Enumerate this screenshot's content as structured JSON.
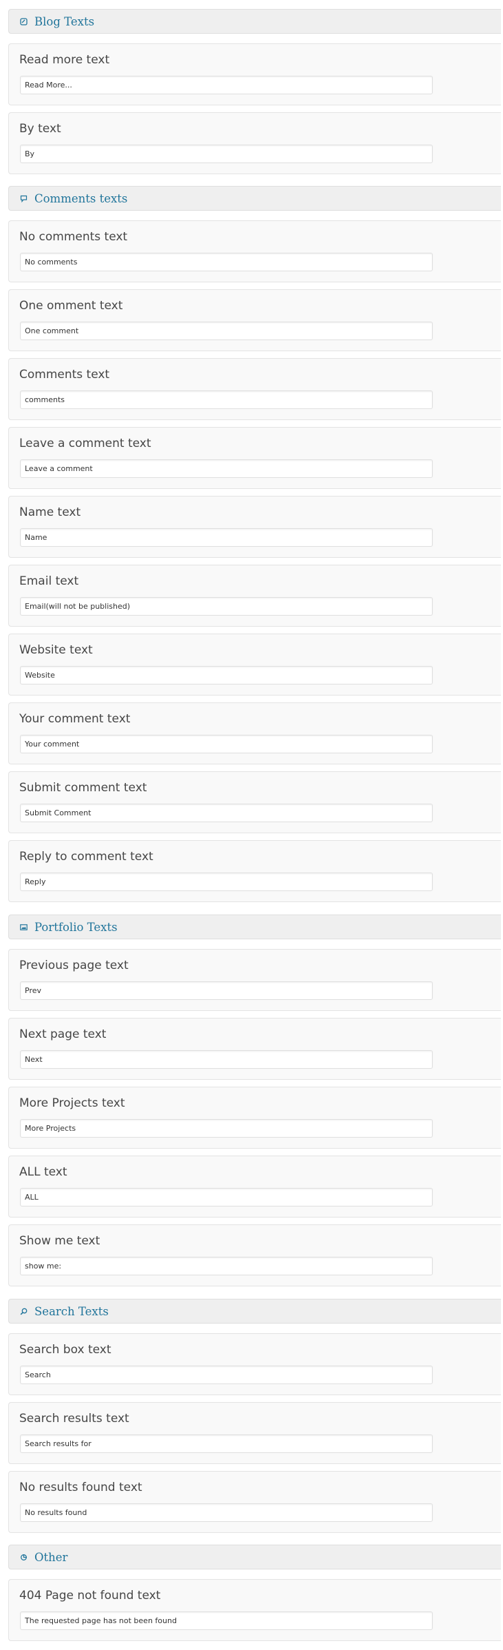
{
  "colors": {
    "section_title": "#21759b",
    "header_bg": "#efefef",
    "box_bg": "#f9f9f9",
    "label": "#464646"
  },
  "sections": [
    {
      "title": "Blog Texts",
      "icon": "blog-icon",
      "fields": [
        {
          "label": "Read more text",
          "value": "Read More..."
        },
        {
          "label": "By text",
          "value": "By"
        }
      ]
    },
    {
      "title": "Comments texts",
      "icon": "comment-icon",
      "fields": [
        {
          "label": "No comments text",
          "value": "No comments"
        },
        {
          "label": "One omment text",
          "value": "One comment"
        },
        {
          "label": "Comments text",
          "value": "comments"
        },
        {
          "label": "Leave a comment text",
          "value": "Leave a comment"
        },
        {
          "label": "Name text",
          "value": "Name"
        },
        {
          "label": "Email text",
          "value": "Email(will not be published)"
        },
        {
          "label": "Website text",
          "value": "Website"
        },
        {
          "label": "Your comment text",
          "value": "Your comment"
        },
        {
          "label": "Submit comment text",
          "value": "Submit Comment"
        },
        {
          "label": "Reply to comment text",
          "value": "Reply"
        }
      ]
    },
    {
      "title": "Portfolio Texts",
      "icon": "image-icon",
      "fields": [
        {
          "label": "Previous page text",
          "value": "Prev"
        },
        {
          "label": "Next page text",
          "value": "Next"
        },
        {
          "label": "More Projects text",
          "value": "More Projects"
        },
        {
          "label": "ALL text",
          "value": "ALL"
        },
        {
          "label": "Show me text",
          "value": "show me:"
        }
      ]
    },
    {
      "title": "Search Texts",
      "icon": "search-icon",
      "fields": [
        {
          "label": "Search box text",
          "value": "Search"
        },
        {
          "label": "Search results text",
          "value": "Search results for"
        },
        {
          "label": "No results found text",
          "value": "No results found"
        }
      ]
    },
    {
      "title": "Other",
      "icon": "other-icon",
      "fields": [
        {
          "label": "404 Page not found text",
          "value": "The requested page has not been found"
        }
      ]
    }
  ]
}
